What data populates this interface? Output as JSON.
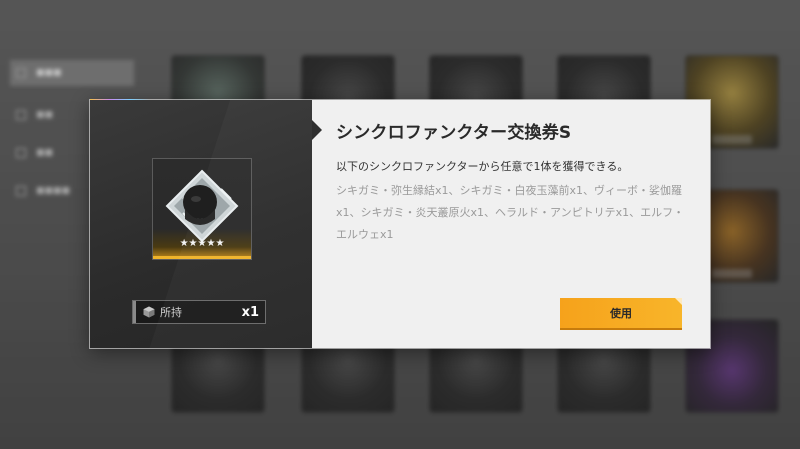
{
  "background": {
    "sidebar_items": [
      {
        "label": "■■■",
        "active": true
      },
      {
        "label": "■■",
        "active": false
      },
      {
        "label": "■■",
        "active": false
      },
      {
        "label": "■■■■",
        "active": false
      }
    ]
  },
  "modal": {
    "title": "シンクロファンクター交換券S",
    "description": "以下のシンクロファンクターから任意で1体を獲得できる。",
    "items_list": "シキガミ・弥生縁結x1、シキガミ・白夜玉藻前x1、ヴィーボ・娑伽羅x1、シキガミ・炎天叢原火x1、ヘラルド・アンピトリテx1、エルフ・エルウェx1",
    "rarity_stars": "★★★★★",
    "owned_label": "所持",
    "owned_count": "x1",
    "use_button_label": "使用"
  },
  "colors": {
    "accent": "#f6a21b",
    "panel_dark": "#2b2b2b",
    "panel_light": "#f0f0f0"
  }
}
